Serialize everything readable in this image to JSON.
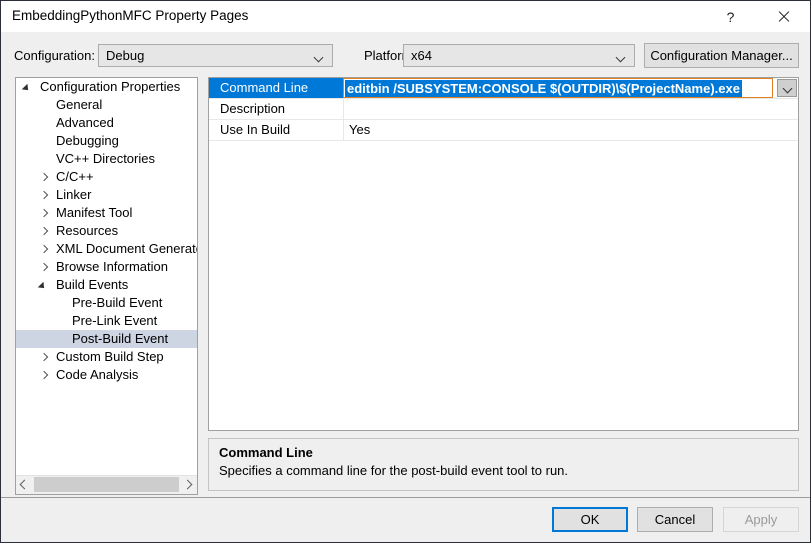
{
  "window": {
    "title": "EmbeddingPythonMFC Property Pages",
    "help_glyph": "?",
    "help_name": "help-button",
    "close_name": "close-button"
  },
  "config_bar": {
    "configuration_label": "Configuration:",
    "configuration_value": "Debug",
    "platform_label": "Platform:",
    "platform_value": "x64",
    "configuration_manager_label": "Configuration Manager..."
  },
  "tree": {
    "items": [
      {
        "label": "Configuration Properties",
        "indent": 0,
        "state": "expanded",
        "selected": false
      },
      {
        "label": "General",
        "indent": 1,
        "state": "none",
        "selected": false
      },
      {
        "label": "Advanced",
        "indent": 1,
        "state": "none",
        "selected": false
      },
      {
        "label": "Debugging",
        "indent": 1,
        "state": "none",
        "selected": false
      },
      {
        "label": "VC++ Directories",
        "indent": 1,
        "state": "none",
        "selected": false
      },
      {
        "label": "C/C++",
        "indent": 1,
        "state": "collapsed",
        "selected": false
      },
      {
        "label": "Linker",
        "indent": 1,
        "state": "collapsed",
        "selected": false
      },
      {
        "label": "Manifest Tool",
        "indent": 1,
        "state": "collapsed",
        "selected": false
      },
      {
        "label": "Resources",
        "indent": 1,
        "state": "collapsed",
        "selected": false
      },
      {
        "label": "XML Document Generator",
        "indent": 1,
        "state": "collapsed",
        "selected": false
      },
      {
        "label": "Browse Information",
        "indent": 1,
        "state": "collapsed",
        "selected": false
      },
      {
        "label": "Build Events",
        "indent": 1,
        "state": "expanded",
        "selected": false
      },
      {
        "label": "Pre-Build Event",
        "indent": 2,
        "state": "none",
        "selected": false
      },
      {
        "label": "Pre-Link Event",
        "indent": 2,
        "state": "none",
        "selected": false
      },
      {
        "label": "Post-Build Event",
        "indent": 2,
        "state": "none",
        "selected": true
      },
      {
        "label": "Custom Build Step",
        "indent": 1,
        "state": "collapsed",
        "selected": false
      },
      {
        "label": "Code Analysis",
        "indent": 1,
        "state": "collapsed",
        "selected": false
      }
    ]
  },
  "property_grid": {
    "rows": [
      {
        "name": "Command Line",
        "value": "editbin /SUBSYSTEM:CONSOLE $(OUTDIR)\\$(ProjectName).exe",
        "selected": true,
        "editing": true
      },
      {
        "name": "Description",
        "value": "",
        "selected": false,
        "editing": false
      },
      {
        "name": "Use In Build",
        "value": "Yes",
        "selected": false,
        "editing": false
      }
    ]
  },
  "description_panel": {
    "title": "Command Line",
    "text": "Specifies a command line for the post-build event tool to run."
  },
  "footer": {
    "ok_label": "OK",
    "cancel_label": "Cancel",
    "apply_label": "Apply"
  },
  "colors": {
    "selection_blue": "#0078d7",
    "tree_selection": "#cdd5e3",
    "dialog_background": "#efefef",
    "editor_border": "#e08020"
  }
}
